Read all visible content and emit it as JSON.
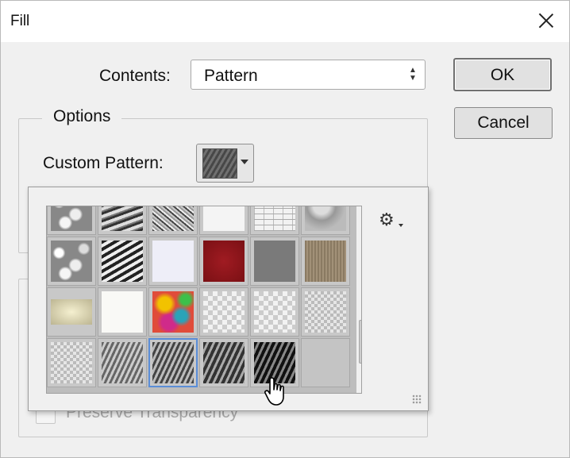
{
  "window": {
    "title": "Fill"
  },
  "contents": {
    "label": "Contents:",
    "value": "Pattern"
  },
  "buttons": {
    "ok": "OK",
    "cancel": "Cancel"
  },
  "options": {
    "legend": "Options",
    "custom_pattern_label": "Custom Pattern:"
  },
  "preserve": {
    "label": "Preserve Transparency",
    "checked": false
  },
  "pattern_picker": {
    "selected_index": 17,
    "patterns": [
      "bubbles",
      "scales",
      "marble",
      "herringbone",
      "bricks",
      "clouds",
      "waves",
      "paper",
      "red-fabric",
      "gray",
      "burlap",
      "parchment",
      "white-paper",
      "tie-dye",
      "checker-light",
      "checker-fine",
      "wavy-1",
      "wavy-2",
      "wavy-3",
      "wavy-4",
      "wavy-5"
    ]
  },
  "icons": {
    "close": "close-icon",
    "gear": "gear-icon",
    "select_arrows": "up-down-arrows-icon",
    "dropdown": "chevron-down-icon",
    "cursor": "hand-pointer-icon"
  }
}
